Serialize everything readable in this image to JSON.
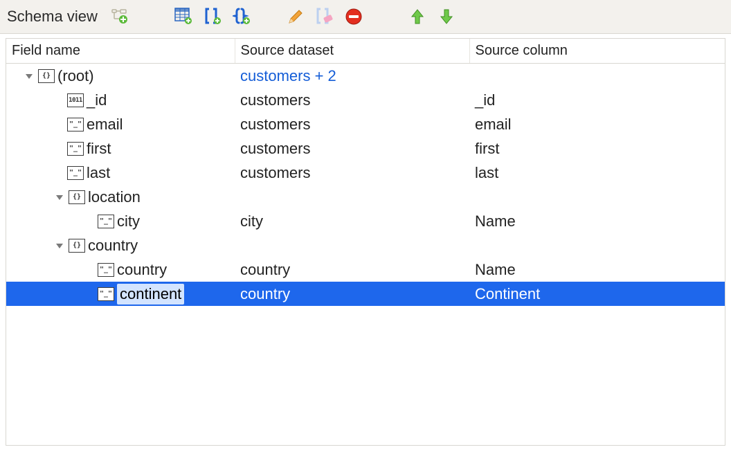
{
  "toolbar": {
    "title": "Schema view",
    "buttons": {
      "new_node": "new-node-icon",
      "table_add": "table-add-icon",
      "brackets_add": "array-add-icon",
      "braces_add": "object-add-icon",
      "edit": "edit-icon",
      "brackets_erase": "clear-icon",
      "delete": "delete-icon",
      "move_up": "move-up-icon",
      "move_down": "move-down-icon"
    }
  },
  "columns": {
    "field_name": "Field name",
    "source_dataset": "Source dataset",
    "source_column": "Source column"
  },
  "tree": [
    {
      "indent": 0,
      "disclosure": "down",
      "icon": "obj",
      "name": "(root)",
      "dataset": "customers + 2",
      "column": "",
      "dataset_link": true
    },
    {
      "indent": 1,
      "disclosure": "none",
      "icon": "binary",
      "name": "_id",
      "dataset": "customers",
      "column": "_id"
    },
    {
      "indent": 1,
      "disclosure": "none",
      "icon": "str",
      "name": "email",
      "dataset": "customers",
      "column": "email"
    },
    {
      "indent": 1,
      "disclosure": "none",
      "icon": "str",
      "name": "first",
      "dataset": "customers",
      "column": "first"
    },
    {
      "indent": 1,
      "disclosure": "none",
      "icon": "str",
      "name": "last",
      "dataset": "customers",
      "column": "last"
    },
    {
      "indent": 1,
      "disclosure": "down",
      "icon": "obj",
      "name": "location",
      "dataset": "",
      "column": ""
    },
    {
      "indent": 2,
      "disclosure": "none",
      "icon": "str",
      "name": "city",
      "dataset": "city",
      "column": "Name"
    },
    {
      "indent": 1,
      "disclosure": "down",
      "icon": "obj",
      "name": "country",
      "dataset": "",
      "column": ""
    },
    {
      "indent": 2,
      "disclosure": "none",
      "icon": "str",
      "name": "country",
      "dataset": "country",
      "column": "Name"
    },
    {
      "indent": 2,
      "disclosure": "none",
      "icon": "str",
      "name": "continent",
      "dataset": "country",
      "column": "Continent",
      "selected": true
    }
  ]
}
